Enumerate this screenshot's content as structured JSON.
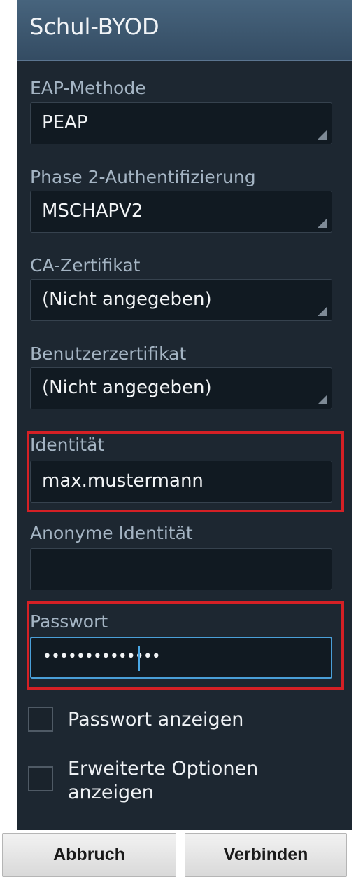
{
  "dialog": {
    "title": "Schul-BYOD"
  },
  "fields": {
    "eap_method": {
      "label": "EAP-Methode",
      "value": "PEAP"
    },
    "phase2": {
      "label": "Phase 2-Authentifizierung",
      "value": "MSCHAPV2"
    },
    "ca_cert": {
      "label": "CA-Zertifikat",
      "value": "(Nicht angegeben)"
    },
    "user_cert": {
      "label": "Benutzerzertifikat",
      "value": "(Nicht angegeben)"
    },
    "identity": {
      "label": "Identität",
      "value": "max.mustermann"
    },
    "anonymous_identity": {
      "label": "Anonyme Identität",
      "value": ""
    },
    "password": {
      "label": "Passwort",
      "value": "••••••••••••••"
    }
  },
  "options": {
    "show_password": {
      "label": "Passwort anzeigen",
      "checked": false
    },
    "advanced": {
      "label": "Erweiterte Optionen anzeigen",
      "checked": false
    }
  },
  "buttons": {
    "cancel": "Abbruch",
    "connect": "Verbinden"
  },
  "colors": {
    "panel_bg": "#1d2731",
    "title_bg": "#3e586f",
    "field_bg": "#111a22",
    "label_text": "#a4b4c3",
    "focus_border": "#4a9fd8",
    "highlight_red": "#d52025"
  }
}
